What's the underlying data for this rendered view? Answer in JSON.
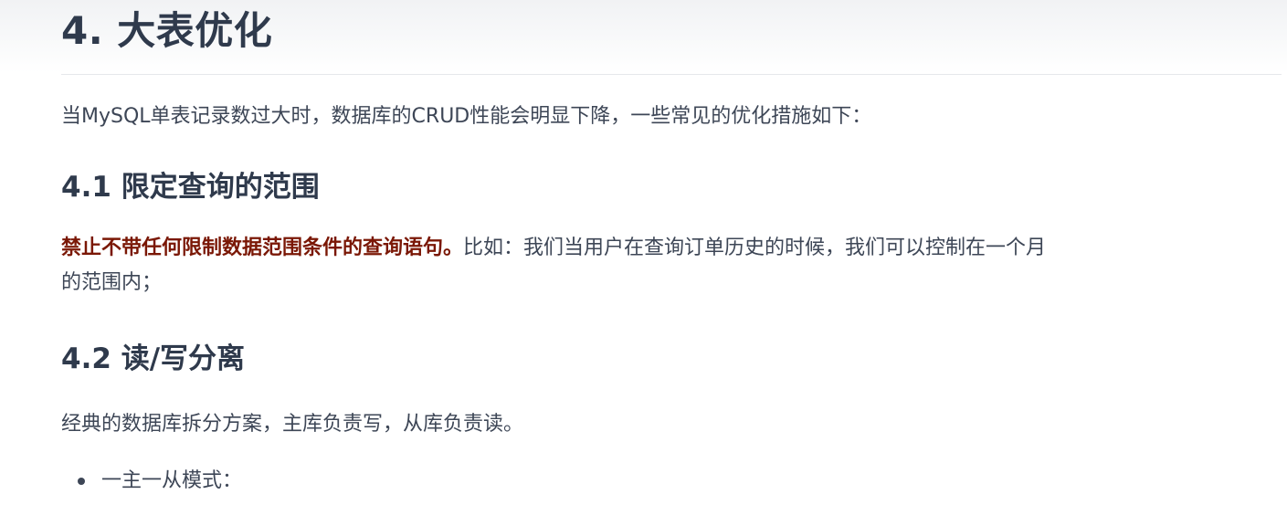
{
  "section": {
    "title": "4. 大表优化",
    "intro": "当MySQL单表记录数过大时，数据库的CRUD性能会明显下降，一些常见的优化措施如下："
  },
  "subsections": [
    {
      "title": "4.1 限定查询的范围",
      "emphasis": "禁止不带任何限制数据范围条件的查询语句。",
      "text_line1": "比如：我们当用户在查询订单历史的时候，我们可以控制在一个月",
      "text_line2": "的范围内；"
    },
    {
      "title": "4.2 读/写分离",
      "text": "经典的数据库拆分方案，主库负责写，从库负责读。",
      "bullets": [
        "一主一从模式："
      ]
    }
  ],
  "colors": {
    "heading": "#2f3a4c",
    "body_text": "#3d4656",
    "emphasis": "#7a1705",
    "rule": "#e6e8eb"
  }
}
